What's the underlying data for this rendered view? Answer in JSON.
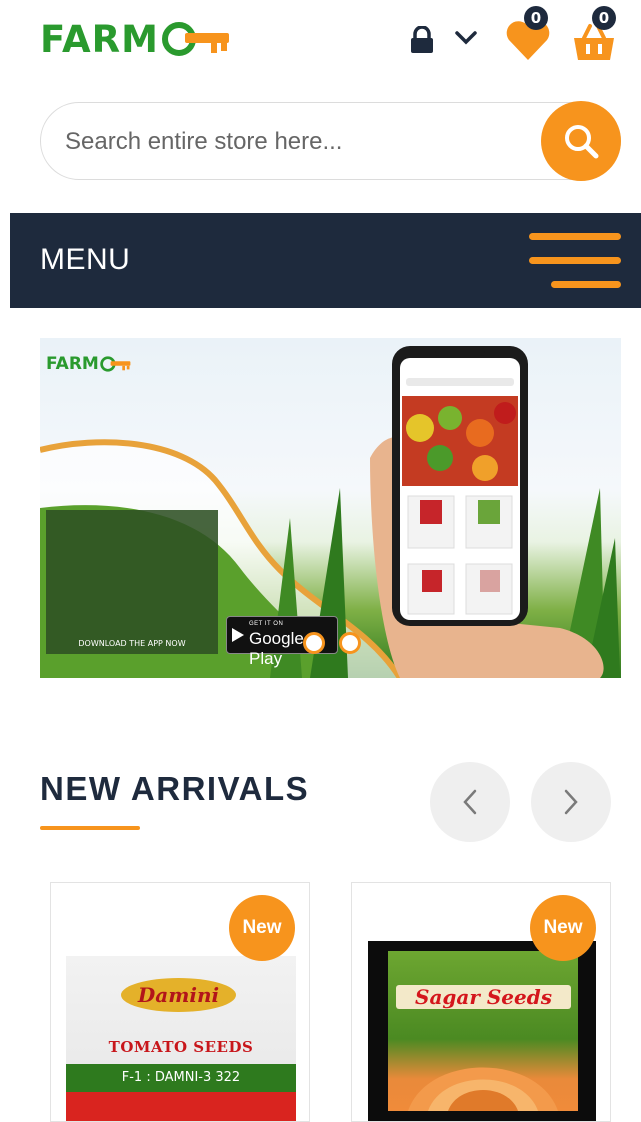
{
  "header": {
    "logo_text": "FARM",
    "wishlist_count": "0",
    "cart_count": "0",
    "icons": [
      "lock-icon",
      "chevron-down-icon",
      "heart-icon",
      "basket-icon"
    ]
  },
  "search": {
    "placeholder": "Search entire store here..."
  },
  "menu": {
    "label": "MENU"
  },
  "banner": {
    "logo_text": "FARM",
    "cta_small": "GET IT ON",
    "cta_big": "Google Play",
    "download_text": "DOWNLOAD THE APP NOW",
    "active_slide": 1,
    "slide_count": 2
  },
  "new_arrivals": {
    "title": "NEW ARRIVALS",
    "products": [
      {
        "badge": "New",
        "brand": "Damini",
        "label": "TOMATO SEEDS",
        "variety": "F-1 : DAMNI-3 322"
      },
      {
        "badge": "New",
        "brand": "Sagar Seeds"
      }
    ]
  },
  "colors": {
    "accent": "#f7941d",
    "dark": "#1e2a3d",
    "brand_green": "#2a9a2e"
  }
}
